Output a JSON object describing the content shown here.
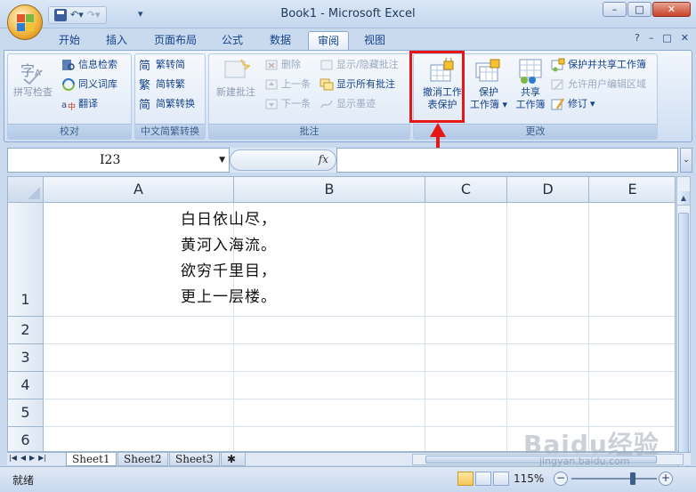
{
  "window": {
    "title": "Book1 - Microsoft Excel",
    "qat_more": "▾",
    "buttons": {
      "minimize": "–",
      "maximize": "□",
      "close": "✕"
    }
  },
  "tabs": [
    {
      "label": "开始"
    },
    {
      "label": "插入"
    },
    {
      "label": "页面布局"
    },
    {
      "label": "公式"
    },
    {
      "label": "数据"
    },
    {
      "label": "审阅"
    },
    {
      "label": "视图"
    }
  ],
  "active_tab": "审阅",
  "ribbon": {
    "proofing": {
      "label": "校对",
      "spell_check": "拼写检查",
      "research": "信息检索",
      "thesaurus": "同义词库",
      "translate": "翻译"
    },
    "chinese_conversion": {
      "label": "中文简繁转换",
      "to_simplified": "繁转简",
      "to_traditional": "简转繁",
      "conversion": "简繁转换"
    },
    "comments": {
      "label": "批注",
      "new_comment": "新建批注",
      "delete": "删除",
      "previous": "上一条",
      "next": "下一条",
      "show_hide": "显示/隐藏批注",
      "show_all": "显示所有批注",
      "show_ink": "显示墨迹"
    },
    "changes": {
      "label": "更改",
      "unprotect_sheet_line1": "撤消工作",
      "unprotect_sheet_line2": "表保护",
      "protect_workbook_line1": "保护",
      "protect_workbook_line2": "工作簿",
      "share_workbook_line1": "共享",
      "share_workbook_line2": "工作簿",
      "protect_share": "保护并共享工作簿",
      "allow_edit_ranges": "允许用户编辑区域",
      "track_changes": "修订"
    }
  },
  "formula_bar": {
    "name_box": "I23",
    "fx": "fx",
    "value": ""
  },
  "grid": {
    "columns": [
      "A",
      "B",
      "C",
      "D",
      "E"
    ],
    "rows": [
      "1",
      "2",
      "3",
      "4",
      "5",
      "6"
    ],
    "cell_a1_lines": [
      "白日依山尽，",
      "黄河入海流。",
      "欲穷千里目，",
      "更上一层楼。"
    ]
  },
  "sheets": [
    "Sheet1",
    "Sheet2",
    "Sheet3"
  ],
  "active_sheet": "Sheet1",
  "status": {
    "mode": "就绪",
    "zoom": "115%"
  },
  "watermark": {
    "brand": "Baidu经验",
    "url": "jingyan.baidu.com"
  },
  "colors": {
    "highlight_box": "#e51717",
    "ribbon_text": "#15428b"
  }
}
